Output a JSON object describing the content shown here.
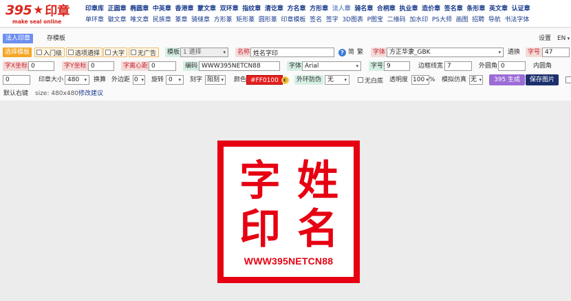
{
  "logo": {
    "number": "395",
    "star": "★",
    "cn": "印章",
    "sub": "make seal online"
  },
  "nav": {
    "top": [
      {
        "label": "印章库",
        "state": ""
      },
      {
        "label": "正圆章",
        "state": ""
      },
      {
        "label": "椭圆章",
        "state": ""
      },
      {
        "label": "中英章",
        "state": ""
      },
      {
        "label": "香港章",
        "state": ""
      },
      {
        "label": "蒙文章",
        "state": ""
      },
      {
        "label": "双环章",
        "state": ""
      },
      {
        "label": "指纹章",
        "state": ""
      },
      {
        "label": "清讫章",
        "state": ""
      },
      {
        "label": "方名章",
        "state": ""
      },
      {
        "label": "方形章",
        "state": ""
      },
      {
        "label": "法人章",
        "state": "active"
      },
      {
        "label": "骑名章",
        "state": ""
      },
      {
        "label": "合柄章",
        "state": ""
      },
      {
        "label": "执业章",
        "state": ""
      },
      {
        "label": "造价章",
        "state": ""
      },
      {
        "label": "签名章",
        "state": ""
      },
      {
        "label": "条形章",
        "state": ""
      },
      {
        "label": "英文章",
        "state": ""
      },
      {
        "label": "认证章",
        "state": ""
      }
    ],
    "bottom": [
      {
        "label": "单环章",
        "state": ""
      },
      {
        "label": "徽文章",
        "state": ""
      },
      {
        "label": "唯文章",
        "state": ""
      },
      {
        "label": "民族章",
        "state": ""
      },
      {
        "label": "篆章",
        "state": ""
      },
      {
        "label": "骑缝章",
        "state": ""
      },
      {
        "label": "方形篆",
        "state": ""
      },
      {
        "label": "矩形篆",
        "state": ""
      },
      {
        "label": "圆形篆",
        "state": ""
      },
      {
        "label": "印章模板",
        "state": ""
      },
      {
        "label": "签名",
        "state": ""
      },
      {
        "label": "签字",
        "state": ""
      },
      {
        "label": "3D图表",
        "state": ""
      },
      {
        "label": "P图宝",
        "state": ""
      },
      {
        "label": "二维码",
        "state": ""
      },
      {
        "label": "加水印",
        "state": ""
      },
      {
        "label": "PS大师",
        "state": ""
      },
      {
        "label": "画图",
        "state": ""
      },
      {
        "label": "招聘",
        "state": ""
      },
      {
        "label": "导航",
        "state": ""
      },
      {
        "label": "书法字体",
        "state": ""
      }
    ]
  },
  "tabs": {
    "active": "法人印章",
    "save_template": "存模板"
  },
  "topright": {
    "settings": "设置",
    "lang": "EN"
  },
  "row1": {
    "choose_template": "选择模板",
    "beginner": "入门级",
    "option_select": "选项遴择",
    "big_char": "大字",
    "no_ads": "无广告",
    "template_label": "模板",
    "template_value": "1 遴择",
    "name_label": "名称",
    "name_value": "姓名字印",
    "info": "?",
    "simp": "简",
    "trad": "繁",
    "font_label": "字体",
    "font_value": "方正华隶_GBK",
    "replace": "遴换",
    "size_label": "字号",
    "size_value": "47"
  },
  "row2": {
    "xpos_label": "字X坐标",
    "xpos_value": "0",
    "ypos_label": "字Y坐标",
    "ypos_value": "0",
    "center_label": "字离心距",
    "center_value": "0",
    "code_label": "编码",
    "code_value": "WWW395NETCN88",
    "font2_label": "字体",
    "font2_value": "Arial",
    "size2_label": "字号",
    "size2_value": "9",
    "border_label": "边框线宽",
    "border_value": "7",
    "outer_radius_label": "外圆角",
    "outer_radius_value": "0",
    "inner_radius_label": "内圆角"
  },
  "row3": {
    "inner_radius_value": "0",
    "stamp_size_label": "印章大小",
    "stamp_size_value": "480",
    "convert": "换算",
    "margin_label": "外边距",
    "margin_value": "0",
    "rotate_label": "旋转",
    "rotate_value": "0",
    "engrave_label": "刻字",
    "engrave_value": "阳刻",
    "color_label": "颜色",
    "color_value": "#FF0100",
    "security_label": "外环防伪",
    "security_value": "无",
    "no_white": "无白底",
    "opacity_label": "透明度",
    "opacity_value": "100",
    "percent": "%",
    "sim_label": "模拟仿真",
    "sim_value": "无",
    "generate": "395 生成",
    "save_image": "保存图片"
  },
  "row4": {
    "default_sign": "默认右键",
    "size_text": "size: 480x480",
    "suggest": "修改建议"
  },
  "stamp": {
    "chars": [
      "字",
      "姓",
      "印",
      "名"
    ],
    "code": "WWW395NETCN88",
    "color": "#e60012"
  }
}
